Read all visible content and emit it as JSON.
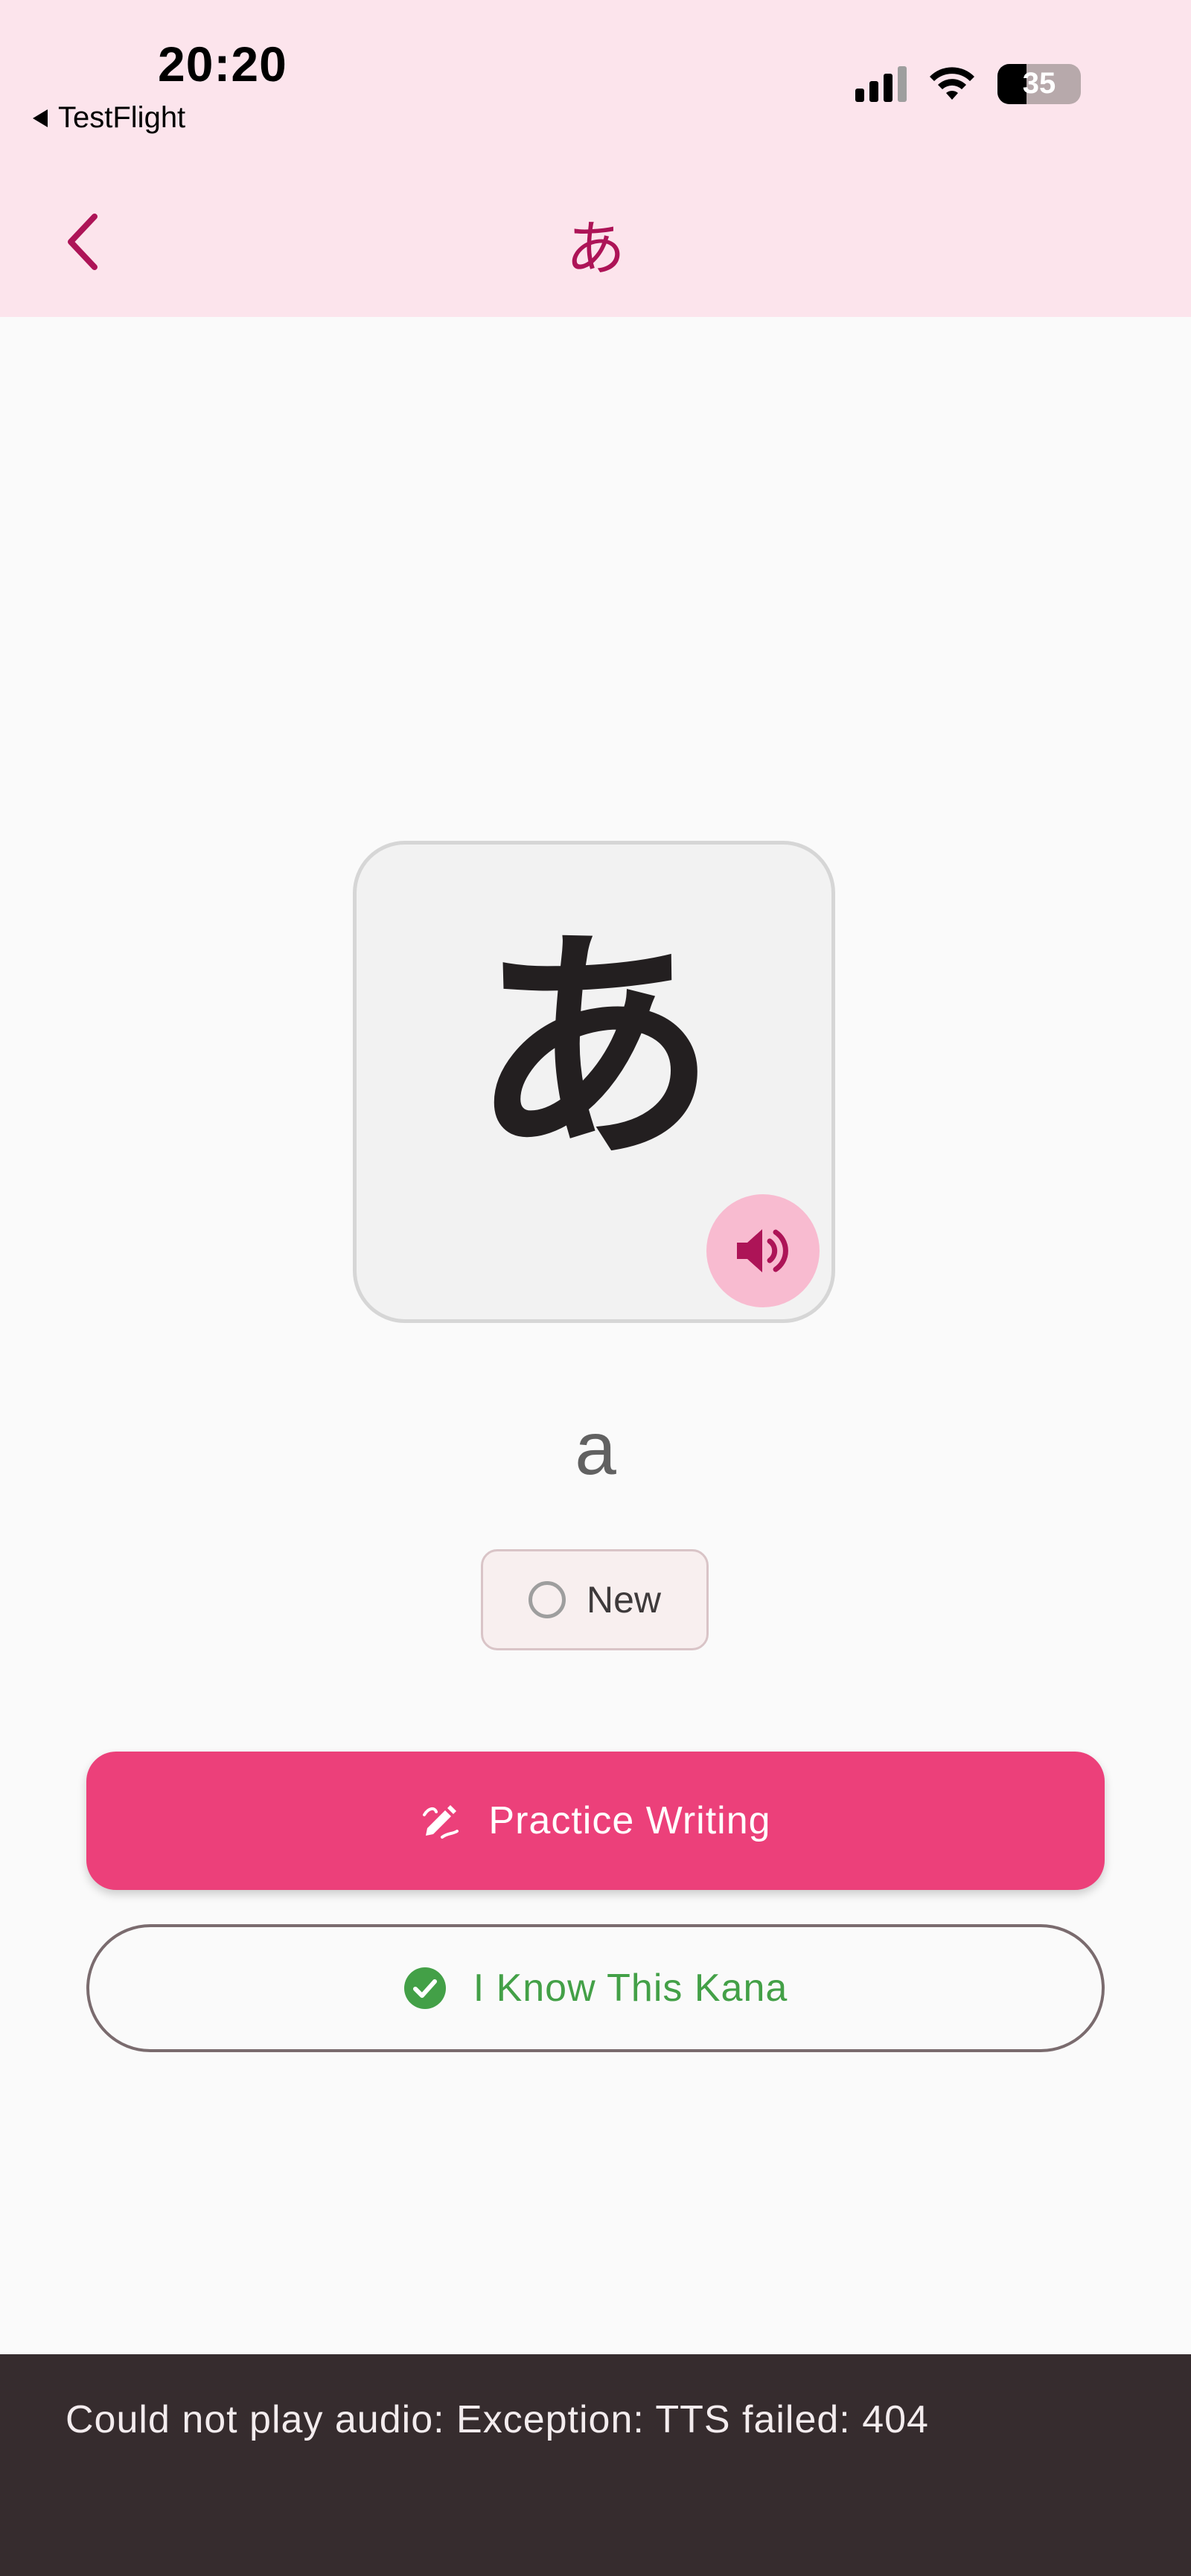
{
  "status_bar": {
    "time": "20:20",
    "back_app": "TestFlight",
    "battery": "35",
    "battery_level": 0.35
  },
  "app_bar": {
    "title": "あ"
  },
  "kana": {
    "character": "あ",
    "romaji": "a"
  },
  "status_chip": {
    "label": "New"
  },
  "actions": {
    "practice_label": "Practice Writing",
    "know_label": "I Know This Kana"
  },
  "snackbar": {
    "message": "Could not play audio: Exception: TTS failed: 404"
  },
  "colors": {
    "header_bg": "#fce4ec",
    "accent": "#ad1457",
    "primary_button": "#ec407a",
    "success": "#43a047",
    "snackbar_bg": "#362c2e"
  }
}
